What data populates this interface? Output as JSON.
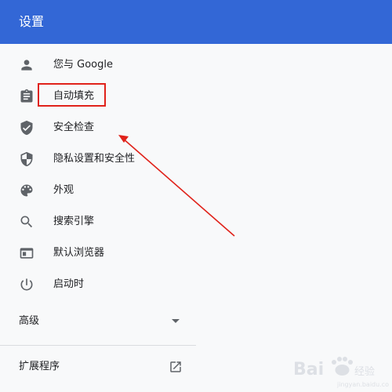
{
  "header": {
    "title": "设置"
  },
  "sidebar": {
    "items": [
      {
        "label": "您与 Google",
        "icon": "person-icon"
      },
      {
        "label": "自动填充",
        "icon": "clipboard-icon"
      },
      {
        "label": "安全检查",
        "icon": "shield-check-icon"
      },
      {
        "label": "隐私设置和安全性",
        "icon": "shield-half-icon"
      },
      {
        "label": "外观",
        "icon": "palette-icon"
      },
      {
        "label": "搜索引擎",
        "icon": "search-icon"
      },
      {
        "label": "默认浏览器",
        "icon": "browser-window-icon"
      },
      {
        "label": "启动时",
        "icon": "power-icon"
      }
    ],
    "advanced_label": "高级",
    "extensions_label": "扩展程序"
  },
  "annotation": {
    "color": "#e0221a"
  },
  "colors": {
    "header": "#3367d6",
    "background": "#f8f9fa",
    "icon": "#5f6368"
  }
}
